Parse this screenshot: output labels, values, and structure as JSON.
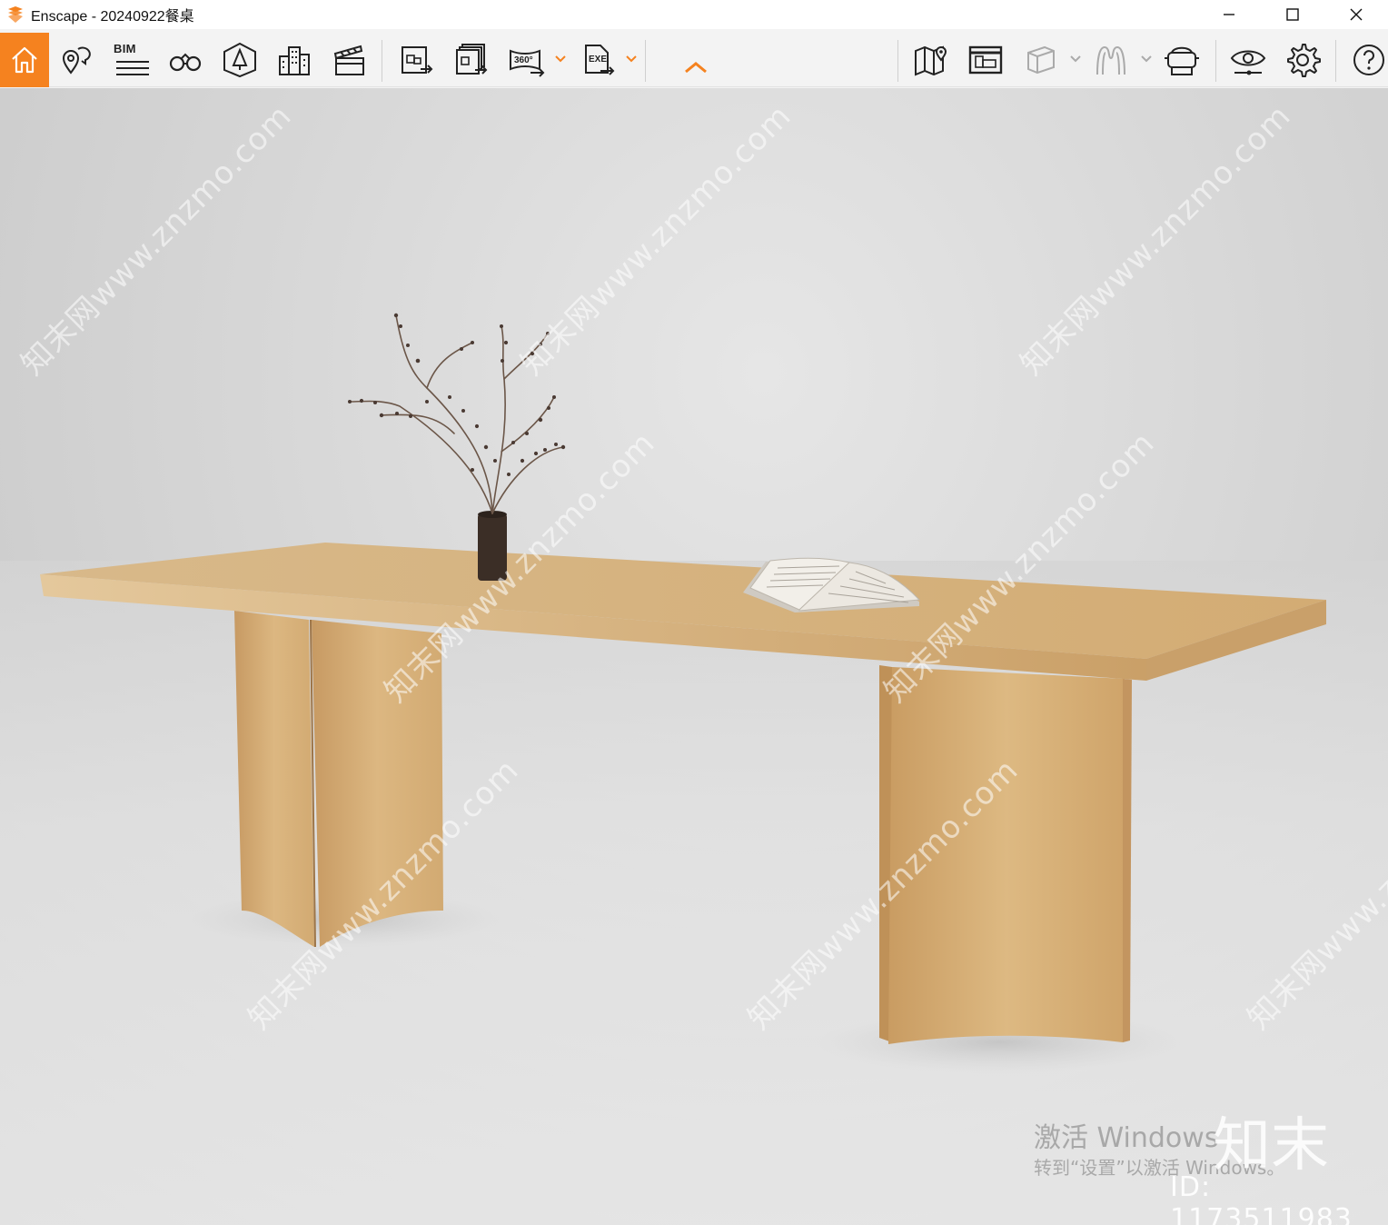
{
  "window": {
    "title": "Enscape - 20240922餐桌",
    "controls": {
      "minimize": "minimize",
      "maximize": "maximize",
      "close": "close"
    }
  },
  "toolbar": {
    "bim_label": "BIM",
    "items": [
      {
        "name": "home",
        "icon": "home-icon",
        "active": true
      },
      {
        "name": "views",
        "icon": "location-pin-icon"
      },
      {
        "name": "bim",
        "icon": "bim-icon"
      },
      {
        "name": "walk",
        "icon": "binoculars-icon"
      },
      {
        "name": "assets",
        "icon": "asset-library-icon"
      },
      {
        "name": "sites",
        "icon": "buildings-icon"
      },
      {
        "name": "video",
        "icon": "clapperboard-icon"
      },
      {
        "name": "screenshot",
        "icon": "screenshot-export-icon"
      },
      {
        "name": "batch",
        "icon": "batch-export-icon"
      },
      {
        "name": "panorama",
        "icon": "panorama-360-icon",
        "label": "360°"
      },
      {
        "name": "export",
        "icon": "exe-export-icon",
        "label": "EXE"
      },
      {
        "name": "collapse",
        "icon": "chevron-up-icon"
      },
      {
        "name": "map",
        "icon": "map-icon"
      },
      {
        "name": "views-manager",
        "icon": "views-manager-icon"
      },
      {
        "name": "box",
        "icon": "cube-icon"
      },
      {
        "name": "mesh",
        "icon": "mesh-icon"
      },
      {
        "name": "vr",
        "icon": "vr-headset-icon"
      },
      {
        "name": "visual-settings",
        "icon": "eye-icon"
      },
      {
        "name": "settings",
        "icon": "gear-icon"
      },
      {
        "name": "help",
        "icon": "help-icon"
      }
    ],
    "accent": "#f5821f"
  },
  "overlay": {
    "activate_title": "激活 Windows",
    "activate_sub": "转到“设置”以激活 Windows。",
    "brand": "知末",
    "id_label": "ID: 1173511983",
    "watermark": "知末网www.znzmo.com"
  }
}
